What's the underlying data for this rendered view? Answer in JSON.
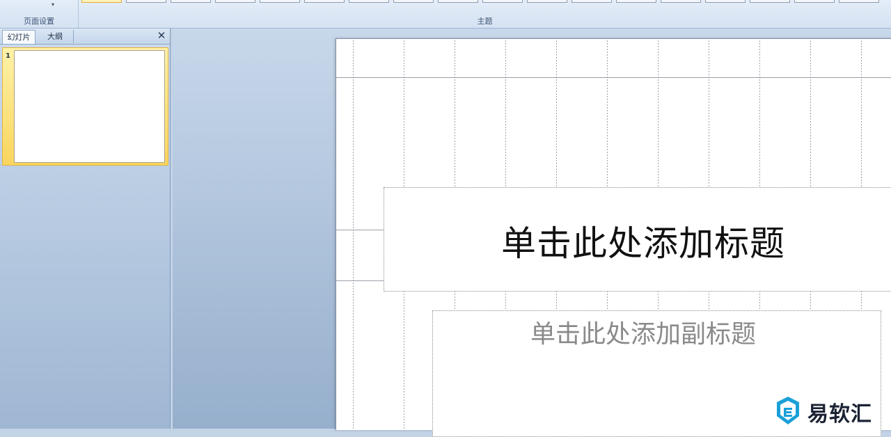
{
  "ribbon": {
    "page_setup_group": {
      "label": "页面设置",
      "dropdown_glyph": "▾"
    },
    "themes_group": {
      "label": "主题",
      "theme_count": 18,
      "selected_index": 0
    }
  },
  "slides_pane": {
    "tabs": [
      {
        "label": "幻灯片",
        "active": true
      },
      {
        "label": "大纲",
        "active": false
      }
    ],
    "close_glyph": "✕",
    "slides": [
      {
        "number": "1",
        "selected": true
      }
    ]
  },
  "slide": {
    "title_placeholder": "单击此处添加标题",
    "subtitle_placeholder": "单击此处添加副标题"
  },
  "watermark": {
    "text": "易软汇",
    "icon": "shield-e-logo-icon",
    "color": "#1aa0d8"
  }
}
